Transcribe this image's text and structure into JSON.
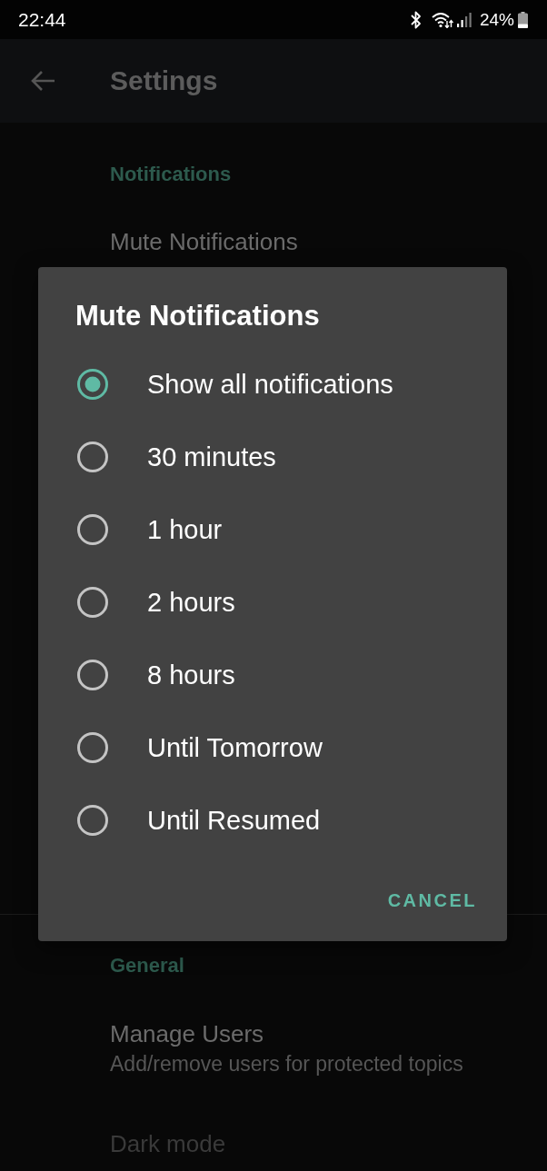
{
  "status_bar": {
    "time": "22:44",
    "battery": "24%"
  },
  "app_bar": {
    "title": "Settings"
  },
  "sections": [
    {
      "title": "Notifications",
      "items": [
        {
          "title": "Mute Notifications",
          "disabled": false
        }
      ]
    },
    {
      "title": "General",
      "items": [
        {
          "title": "Manage Users",
          "summary": "Add/remove users for protected topics",
          "disabled": false
        },
        {
          "title": "Dark mode",
          "disabled": true
        }
      ]
    }
  ],
  "dialog": {
    "title": "Mute Notifications",
    "options": [
      {
        "label": "Show all notifications",
        "selected": true
      },
      {
        "label": "30 minutes",
        "selected": false
      },
      {
        "label": "1 hour",
        "selected": false
      },
      {
        "label": "2 hours",
        "selected": false
      },
      {
        "label": "8 hours",
        "selected": false
      },
      {
        "label": "Until Tomorrow",
        "selected": false
      },
      {
        "label": "Until Resumed",
        "selected": false
      }
    ],
    "buttons": [
      "CANCEL"
    ]
  }
}
